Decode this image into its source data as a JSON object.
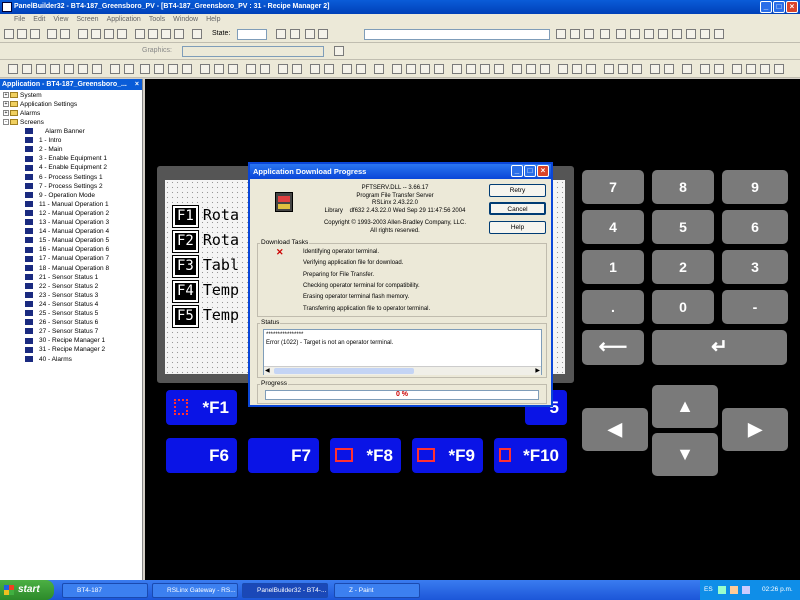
{
  "window": {
    "title": "PanelBuilder32 - BT4-187_Greensboro_PV - [BT4-187_Greensboro_PV : 31 - Recipe Manager 2]",
    "controls": [
      "_",
      "□",
      "×"
    ]
  },
  "menu": [
    "File",
    "Edit",
    "View",
    "Screen",
    "Application",
    "Tools",
    "Window",
    "Help"
  ],
  "toolbar": {
    "state_label": "State:",
    "graphics_label": "Graphics:"
  },
  "left_pane": {
    "title": "Application - BT4-187_Greensboro_...",
    "folders": [
      "System",
      "Application Settings",
      "Alarms",
      "Screens"
    ],
    "screens": [
      "Alarm Banner",
      "1 - Intro",
      "2 - Main",
      "3 - Enable Equipment 1",
      "4 - Enable Equipment 2",
      "6 - Process Settings 1",
      "7 - Process Settings 2",
      "9 - Operation Mode",
      "11 - Manual Operation 1",
      "12 - Manual Operation 2",
      "13 - Manual Operation 3",
      "14 - Manual Operation 4",
      "15 - Manual Operation 5",
      "16 - Manual Operation 6",
      "17 - Manual Operation 7",
      "18 - Manual Operation 8",
      "21 - Sensor Status 1",
      "22 - Sensor Status 2",
      "23 - Sensor Status 3",
      "24 - Sensor Status 4",
      "25 - Sensor Status 5",
      "26 - Sensor Status 6",
      "27 - Sensor Status 7",
      "30 - Recipe Manager 1",
      "31 - Recipe Manager 2",
      "40 - Alarms"
    ]
  },
  "panel": {
    "screen_rows": [
      {
        "key": "F1",
        "text": "Rota"
      },
      {
        "key": "F2",
        "text": "Rota"
      },
      {
        "key": "F3",
        "text": "Tabl"
      },
      {
        "key": "F4",
        "text": "Temp"
      },
      {
        "key": "F5",
        "text": "Temp"
      }
    ],
    "keypad": [
      "7",
      "8",
      "9",
      "4",
      "5",
      "6",
      "1",
      "2",
      "3",
      ".",
      "0",
      "-"
    ],
    "fkeys_row1": [
      "*F1",
      "5"
    ],
    "fkeys_row2": [
      "F6",
      "F7",
      "*F8",
      "*F9",
      "*F10"
    ]
  },
  "dialog": {
    "title": "Application Download Progress",
    "info": {
      "name": "PFTSERV.DLL -- 3.66.17",
      "desc1": "Program File Transfer Server",
      "desc2": "RSLinx 2.43.22.0",
      "library_label": "Library",
      "library_value": "df632 2.43.22.0 Wed Sep 29 11:47:56 2004",
      "copyright1": "Copyright © 1993-2003 Allen-Bradley Company, LLC.",
      "copyright2": "All rights reserved."
    },
    "buttons": {
      "retry": "Retry",
      "cancel": "Cancel",
      "help": "Help"
    },
    "tasks_label": "Download Tasks",
    "tasks": [
      "Identifying operator terminal.",
      "Verifying application file for download.",
      "Preparing for File Transfer.",
      "Checking operator terminal for compatibility.",
      "Erasing operator terminal flash memory.",
      "Transferring application file to operator terminal."
    ],
    "status_label": "Status",
    "status_lines": [
      "****************",
      "Error (1022) - Target is not an operator terminal."
    ],
    "progress_label": "Progress",
    "progress_text": "0 %",
    "progress_value": 0
  },
  "taskbar": {
    "start": "start",
    "items": [
      "BT4-187",
      "RSLinx Gateway - RS...",
      "PanelBuilder32 - BT4-...",
      "Z - Paint"
    ],
    "lang": "ES",
    "clock": "02:26 p.m."
  },
  "colors": {
    "titlebar": "#0a5cd8",
    "fkey_blue": "#0a14e6",
    "keypad_gray": "#7a7a7a",
    "error_red": "#cc0000"
  }
}
